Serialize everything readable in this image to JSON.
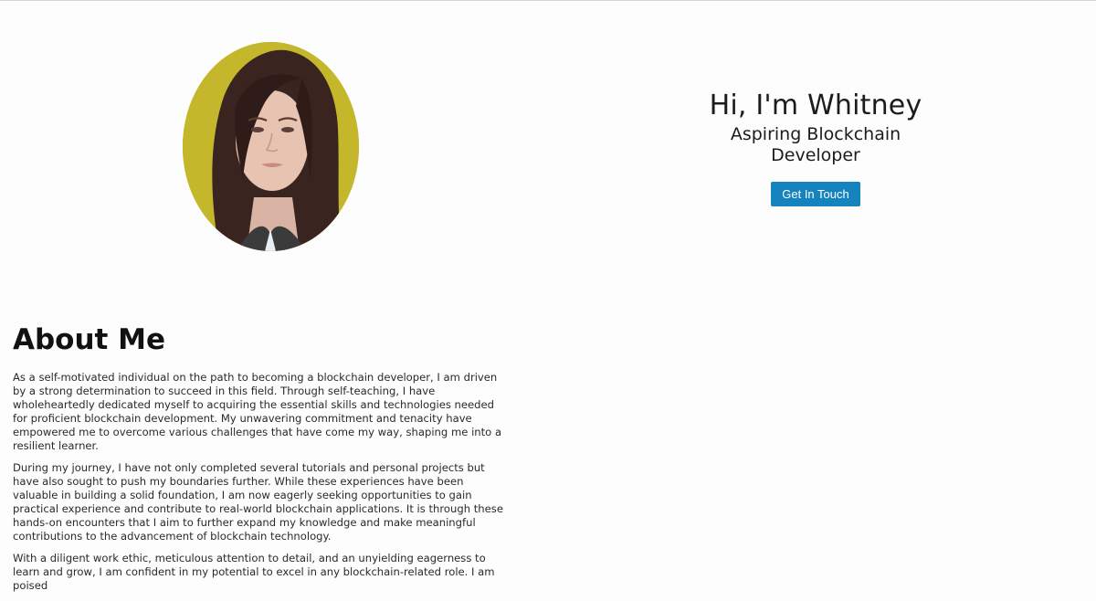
{
  "hero": {
    "photo_alt": "Portrait photo of Whitney",
    "photo_bg_color": "#c4b62a",
    "greeting": "Hi, I'm Whitney",
    "role": "Aspiring Blockchain Developer",
    "cta_label": "Get In Touch",
    "cta_color": "#1584be"
  },
  "about": {
    "title": "About Me",
    "paragraphs": [
      "As a self-motivated individual on the path to becoming a blockchain developer, I am driven by a strong determination to succeed in this field. Through self-teaching, I have wholeheartedly dedicated myself to acquiring the essential skills and technologies needed for proficient blockchain development. My unwavering commitment and tenacity have empowered me to overcome various challenges that have come my way, shaping me into a resilient learner.",
      "During my journey, I have not only completed several tutorials and personal projects but have also sought to push my boundaries further. While these experiences have been valuable in building a solid foundation, I am now eagerly seeking opportunities to gain practical experience and contribute to real-world blockchain applications. It is through these hands-on encounters that I aim to further expand my knowledge and make meaningful contributions to the advancement of blockchain technology.",
      "With a diligent work ethic, meticulous attention to detail, and an unyielding eagerness to learn and grow, I am confident in my potential to excel in any blockchain-related role. I am poised"
    ]
  }
}
